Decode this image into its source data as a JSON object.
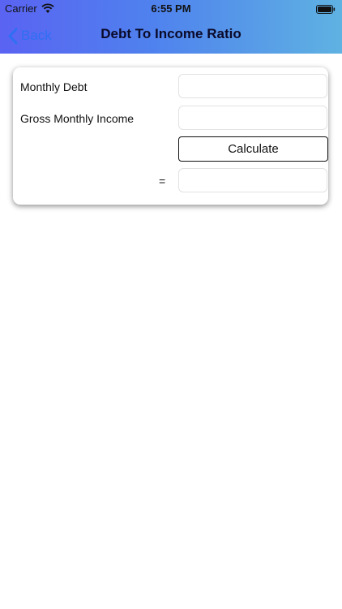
{
  "status_bar": {
    "carrier": "Carrier",
    "time": "6:55 PM",
    "wifi_icon": "wifi-icon",
    "battery_icon": "battery-icon"
  },
  "nav": {
    "back_label": "Back",
    "back_icon": "chevron-left-icon",
    "title": "Debt To Income Ratio",
    "colors": {
      "gradient_start": "#5a63f2",
      "gradient_end": "#5fb2e2",
      "back_tint": "#2f6ff3"
    }
  },
  "form": {
    "monthly_debt_label": "Monthly Debt",
    "monthly_debt_value": "",
    "gross_income_label": "Gross Monthly Income",
    "gross_income_value": "",
    "calculate_label": "Calculate",
    "equals_label": "=",
    "result_value": ""
  }
}
